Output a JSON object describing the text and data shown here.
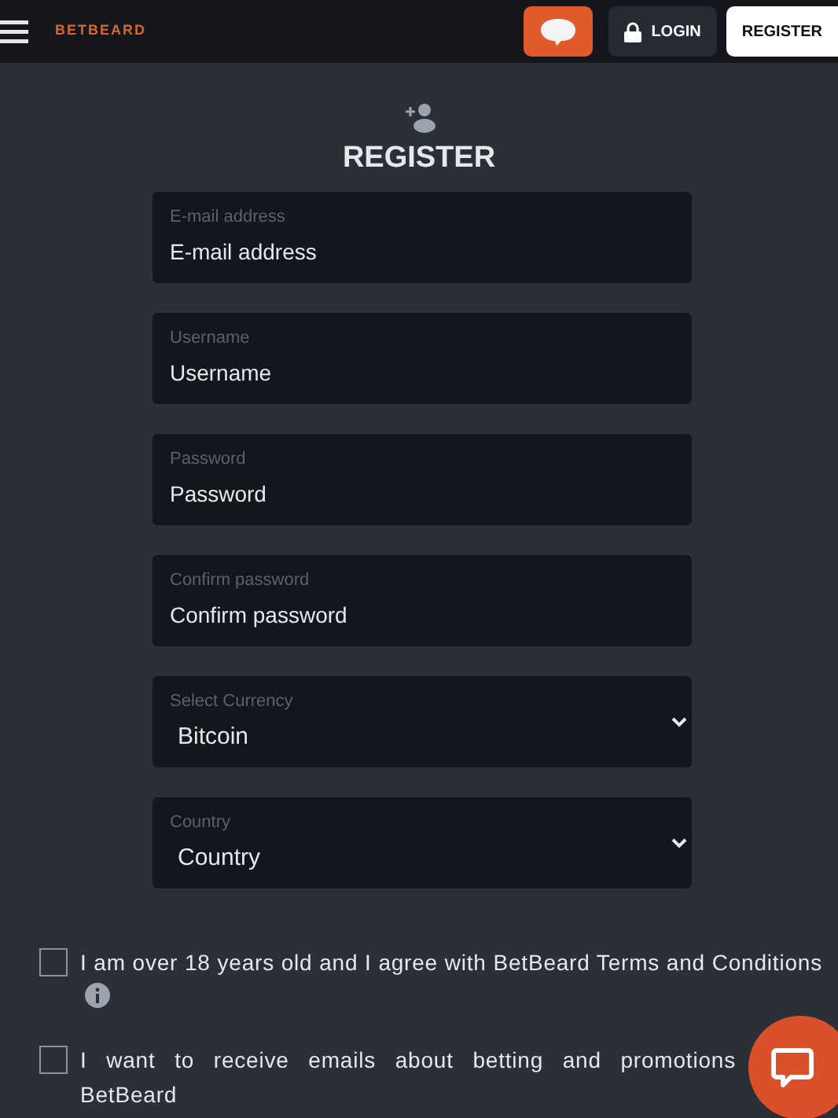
{
  "header": {
    "logo": "BETBEARD",
    "login": "LOGIN",
    "register": "REGISTER"
  },
  "title": "REGISTER",
  "fields": [
    {
      "kind": "text",
      "label": "E-mail address",
      "placeholder": "E-mail address"
    },
    {
      "kind": "text",
      "label": "Username",
      "placeholder": "Username"
    },
    {
      "kind": "text",
      "label": "Password",
      "placeholder": "Password"
    },
    {
      "kind": "text",
      "label": "Confirm password",
      "placeholder": "Confirm password"
    },
    {
      "kind": "select",
      "label": "Select Currency",
      "value": "Bitcoin"
    },
    {
      "kind": "select",
      "label": "Country",
      "value": "Country"
    }
  ],
  "consents": [
    {
      "text": "I am over 18 years old and I agree with BetBeard Terms and Conditions",
      "info": true,
      "checked": false
    },
    {
      "text": "I want to receive emails about betting and promotions BetBeard",
      "info": false,
      "checked": false
    }
  ]
}
